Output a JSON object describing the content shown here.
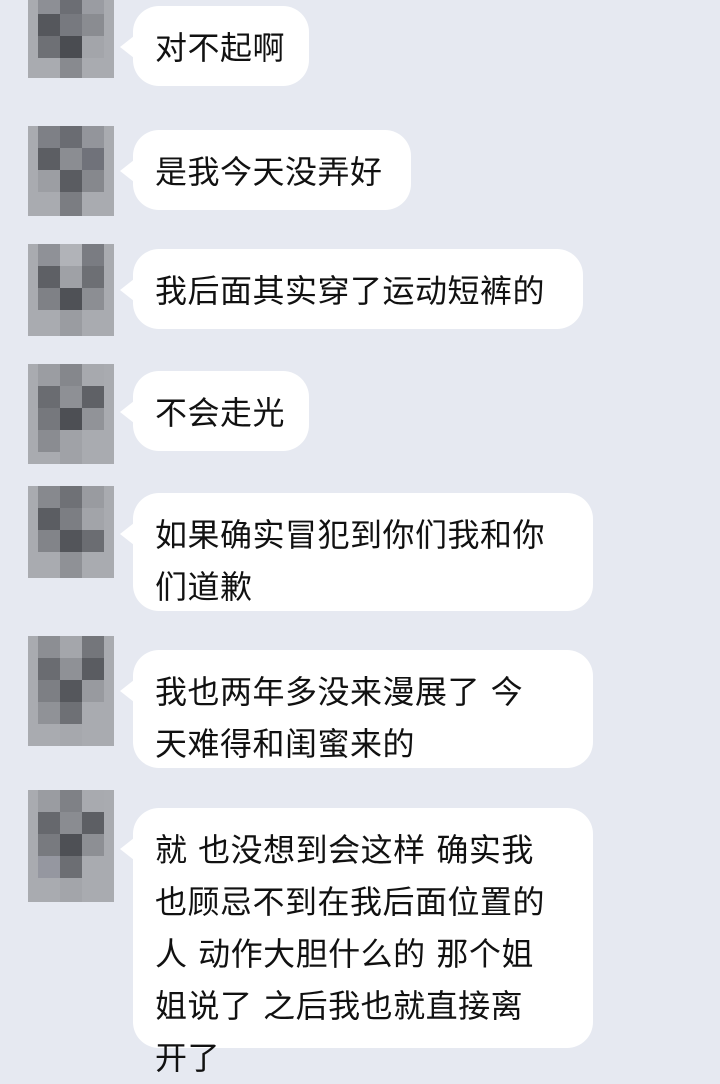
{
  "chat": {
    "messages": [
      {
        "text": "对不起啊"
      },
      {
        "text": "是我今天没弄好"
      },
      {
        "text": "我后面其实穿了运动短裤的"
      },
      {
        "text": "不会走光"
      },
      {
        "text": "如果确实冒犯到你们我和你\n们道歉"
      },
      {
        "text": "我也两年多没来漫展了 今\n天难得和闺蜜来的"
      },
      {
        "text": "就 也没想到会这样 确实我\n也顾忌不到在我后面位置的\n人 动作大胆什么的 那个姐\n姐说了 之后我也就直接离\n开了"
      }
    ]
  },
  "colors": {
    "background": "#e6e9f1",
    "bubble": "#ffffff",
    "text": "#111111"
  }
}
